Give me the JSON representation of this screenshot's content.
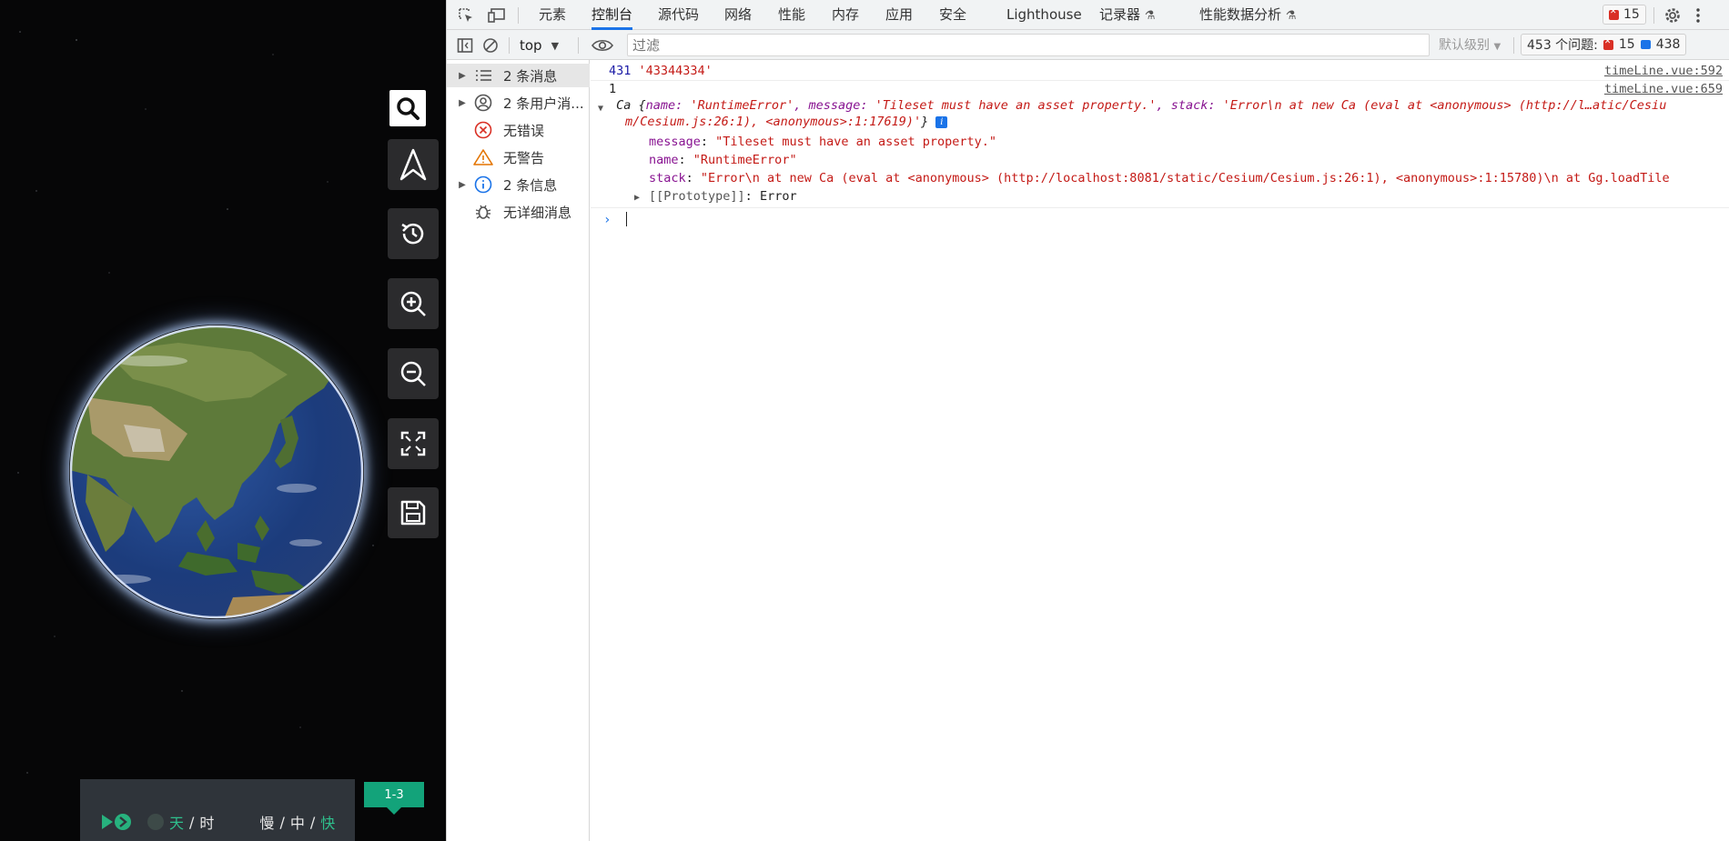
{
  "map": {
    "time_unit_day": "天",
    "time_unit_hour": "时",
    "speed_slow": "慢",
    "speed_mid": "中",
    "speed_fast": "快",
    "sep": "/",
    "tag": "1-3",
    "tools": [
      "search-icon",
      "compass-north-icon",
      "history-icon",
      "zoom-in-icon",
      "zoom-out-icon",
      "fullscreen-icon",
      "save-icon"
    ]
  },
  "devtools": {
    "tabs": [
      "元素",
      "控制台",
      "源代码",
      "网络",
      "性能",
      "内存",
      "应用",
      "安全",
      "Lighthouse",
      "记录器",
      "性能数据分析"
    ],
    "active_tab": "控制台",
    "error_badge_count": "15",
    "toolbar": {
      "context": "top",
      "filter_placeholder": "过滤",
      "level": "默认级别",
      "issues_label": "453 个问题:",
      "issues_errors": "15",
      "issues_messages": "438"
    },
    "sidebar": [
      {
        "label": "2 条消息"
      },
      {
        "label": "2 条用户消..."
      },
      {
        "label": "无错误"
      },
      {
        "label": "无警告"
      },
      {
        "label": "2 条信息"
      },
      {
        "label": "无详细消息"
      }
    ],
    "console": {
      "line1": {
        "num": "431",
        "str": "'43344334'",
        "source": "timeLine.vue:592"
      },
      "line2": {
        "num": "1",
        "source": "timeLine.vue:659"
      },
      "obj_head_a": "Ca {",
      "obj_key_name": "name: ",
      "obj_val_name": "'RuntimeError'",
      "obj_key_message": ", message: ",
      "obj_val_message": "'Tileset must have an asset property.'",
      "obj_key_stack": ", stack: ",
      "obj_val_stack_1": "'Error\\n    at new Ca (eval at <anonymous> (http://l…atic/Cesiu",
      "obj_val_stack_2": "m/Cesium.js:26:1), <anonymous>:1:17619)'",
      "obj_close": "}",
      "prop_message_key": "message",
      "prop_message_val": "\"Tileset must have an asset property.\"",
      "prop_name_key": "name",
      "prop_name_val": "\"RuntimeError\"",
      "prop_stack_key": "stack",
      "prop_stack_val": "\"Error\\n    at new Ca (eval at <anonymous> (http://localhost:8081/static/Cesium/Cesium.js:26:1), <anonymous>:1:15780)\\n    at Gg.loadTile",
      "proto_key": "[[Prototype]]",
      "proto_val": "Error",
      "colon": ": "
    }
  }
}
